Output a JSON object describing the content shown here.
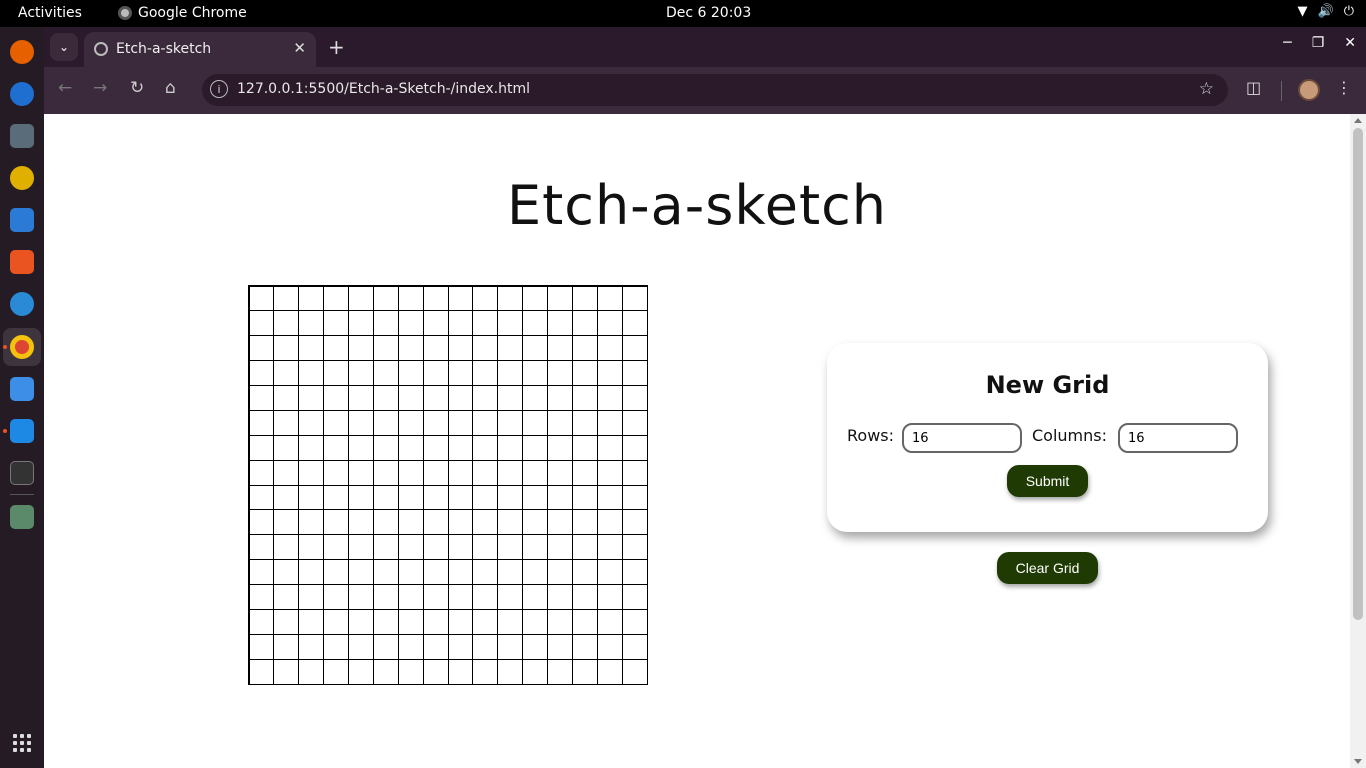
{
  "system": {
    "activities": "Activities",
    "app_name": "Google Chrome",
    "clock": "Dec 6  20:03"
  },
  "browser": {
    "tab_title": "Etch-a-sketch",
    "url": "127.0.0.1:5500/Etch-a-Sketch-/index.html"
  },
  "page": {
    "heading": "Etch-a-sketch",
    "grid": {
      "rows": 16,
      "columns": 16
    },
    "form": {
      "title": "New Grid",
      "rows_label": "Rows:",
      "rows_value": "16",
      "columns_label": "Columns:",
      "columns_value": "16",
      "submit_label": "Submit"
    },
    "clear_label": "Clear Grid"
  },
  "colors": {
    "button": "#1f3a03",
    "accent": "#e95420"
  },
  "dock_icons": [
    "firefox-icon",
    "thunderbird-icon",
    "files-icon",
    "rhythmbox-icon",
    "writer-icon",
    "software-icon",
    "help-icon",
    "chrome-icon",
    "text-editor-icon",
    "vscode-icon",
    "terminal-icon",
    "trash-icon",
    "app-grid-icon"
  ]
}
